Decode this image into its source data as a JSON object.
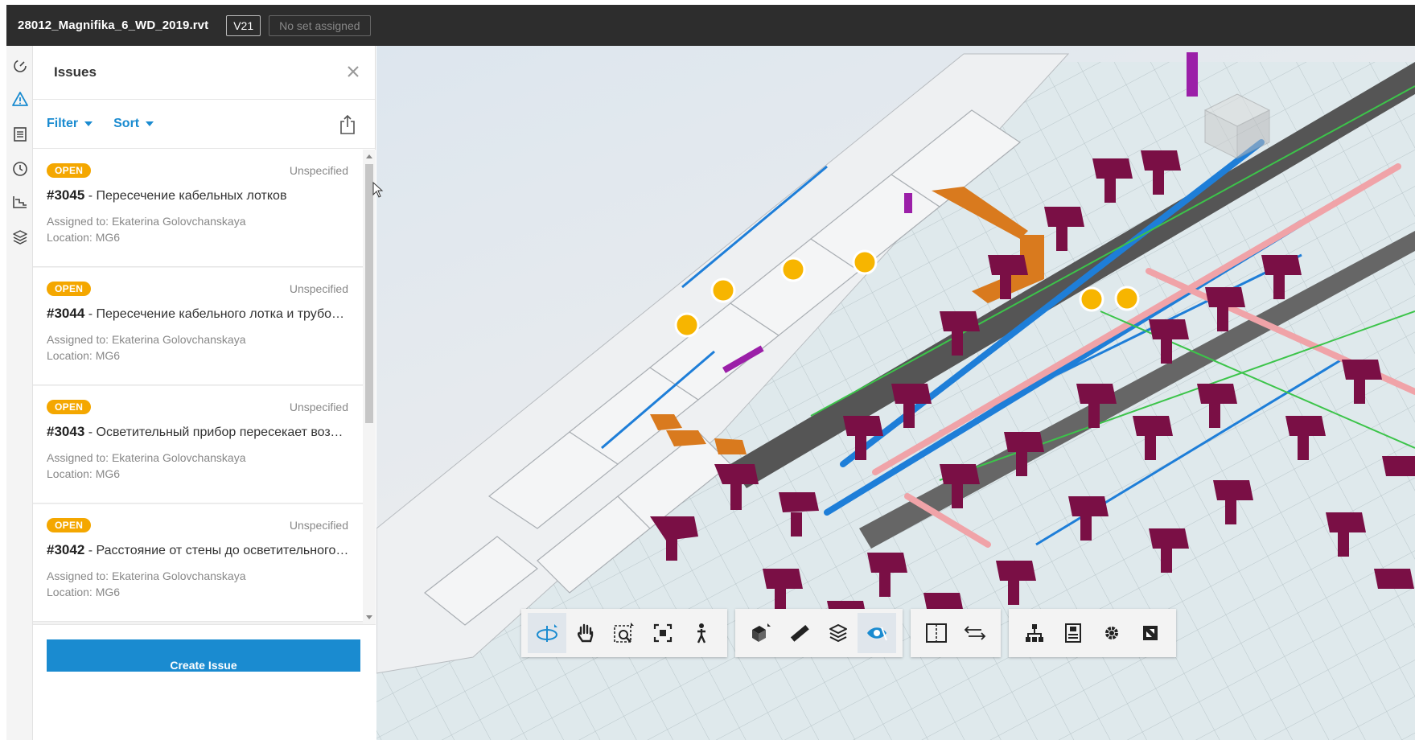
{
  "topbar": {
    "file_name": "28012_Magnifika_6_WD_2019.rvt",
    "version": "V21",
    "set_label": "No set assigned"
  },
  "rail": {
    "items": [
      "gauge-icon",
      "warning-icon",
      "sheets-icon",
      "clock-icon",
      "chart-icon",
      "layers-icon"
    ]
  },
  "panel": {
    "title": "Issues",
    "filter_label": "Filter",
    "sort_label": "Sort",
    "create_label": "Create Issue",
    "issues": [
      {
        "status": "OPEN",
        "priority": "Unspecified",
        "number": "#3045",
        "title": "Пересечение кабельных лотков",
        "assigned": "Assigned to: Ekaterina Golovchanskaya",
        "location": "Location: MG6"
      },
      {
        "status": "OPEN",
        "priority": "Unspecified",
        "number": "#3044",
        "title": "Пересечение кабельного лотка и трубопровода",
        "assigned": "Assigned to: Ekaterina Golovchanskaya",
        "location": "Location: MG6"
      },
      {
        "status": "OPEN",
        "priority": "Unspecified",
        "number": "#3043",
        "title": "Осветительный прибор пересекает воздуховод",
        "assigned": "Assigned to: Ekaterina Golovchanskaya",
        "location": "Location: MG6"
      },
      {
        "status": "OPEN",
        "priority": "Unspecified",
        "number": "#3042",
        "title": "Расстояние от стены до осветительного прибора",
        "assigned": "Assigned to: Ekaterina Golovchanskaya",
        "location": "Location: MG6"
      }
    ]
  },
  "viewer": {
    "toolbar_groups": [
      [
        "orbit-icon",
        "pan-icon",
        "zoom-window-icon",
        "fit-view-icon",
        "first-person-icon"
      ],
      [
        "section-box-icon",
        "measure-icon",
        "explode-icon",
        "visibility-icon"
      ],
      [
        "split-view-icon",
        "compare-icon"
      ],
      [
        "model-browser-icon",
        "properties-icon",
        "settings-icon",
        "fullscreen-icon"
      ]
    ],
    "colors": {
      "pipe_blue": "#1e7ed8",
      "duct_orange": "#d97a1e",
      "beam_maroon": "#7a0f45",
      "pink_pipe": "#f0a3a8",
      "issue_pin": "#f7b500",
      "slab": "#d7e6ea"
    }
  }
}
